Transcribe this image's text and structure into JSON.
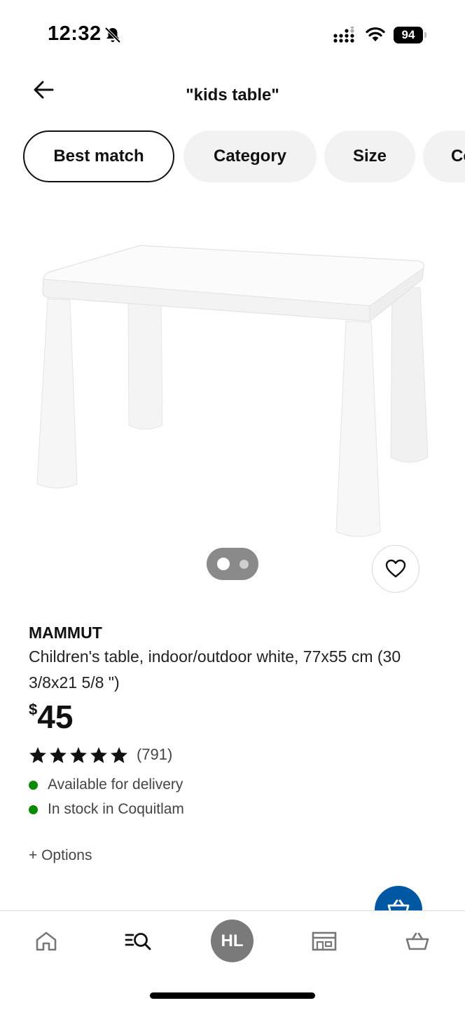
{
  "status_bar": {
    "time": "12:32",
    "battery": "94",
    "icons": [
      "bell-slash-icon",
      "signal-icon",
      "wifi-icon",
      "battery-icon"
    ]
  },
  "header": {
    "title": "\"kids table\"",
    "back_icon": "arrow-left-icon"
  },
  "filters": [
    {
      "label": "Best match",
      "active": true
    },
    {
      "label": "Category",
      "active": false
    },
    {
      "label": "Size",
      "active": false
    },
    {
      "label": "Co",
      "active": false
    }
  ],
  "product": {
    "image_icon": "white-kids-table-image",
    "carousel": {
      "count": 2,
      "current": 1
    },
    "favorite_icon": "heart-icon",
    "name": "MAMMUT",
    "description": "Children's table, indoor/outdoor white, 77x55 cm (30 3/8x21 5/8 \")",
    "price_currency": "$",
    "price_amount": "45",
    "rating_stars": 5,
    "rating_count": "(791)",
    "availability": [
      {
        "text": "Available for delivery",
        "color": "#0a8a00"
      },
      {
        "text": "In stock in Coquitlam",
        "color": "#0a8a00"
      }
    ],
    "options_label": "+ Options"
  },
  "fab": {
    "icon": "add-to-cart-icon",
    "color": "#0058a3"
  },
  "bottom_nav": {
    "items": [
      "home-icon",
      "search-icon",
      "avatar",
      "store-icon",
      "cart-icon"
    ],
    "avatar_initials": "HL"
  }
}
